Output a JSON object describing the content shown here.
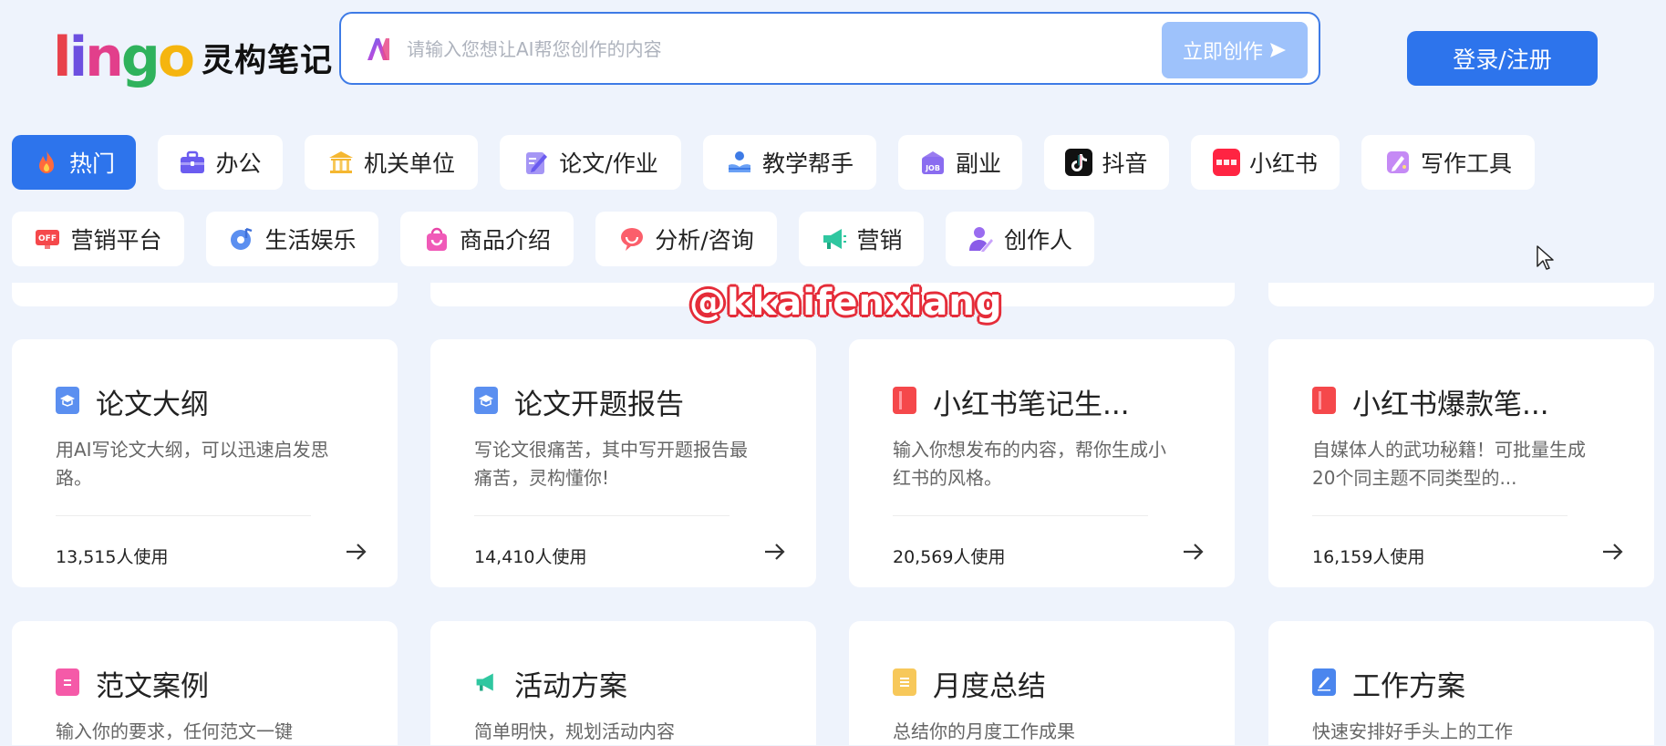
{
  "header": {
    "logo_mark": "lingo",
    "logo_text": "灵构笔记",
    "search_placeholder": "请输入您想让AI帮您创作的内容",
    "create_label": "立即创作",
    "login_label": "登录/注册"
  },
  "colors": {
    "accent": "#2d74ec",
    "background": "#eef3fc",
    "create_button": "#9ec2fb"
  },
  "categories": [
    {
      "label": "热门",
      "icon": "fire-icon",
      "active": true
    },
    {
      "label": "办公",
      "icon": "briefcase-icon"
    },
    {
      "label": "机关单位",
      "icon": "government-building-icon"
    },
    {
      "label": "论文/作业",
      "icon": "pencil-paper-icon"
    },
    {
      "label": "教学帮手",
      "icon": "teaching-hand-icon"
    },
    {
      "label": "副业",
      "icon": "job-bag-icon"
    },
    {
      "label": "抖音",
      "icon": "tiktok-icon"
    },
    {
      "label": "小红书",
      "icon": "xiaohongshu-icon"
    },
    {
      "label": "写作工具",
      "icon": "writing-pen-icon"
    },
    {
      "label": "营销平台",
      "icon": "marketing-screen-icon"
    },
    {
      "label": "生活娱乐",
      "icon": "music-disc-icon"
    },
    {
      "label": "商品介绍",
      "icon": "shopping-bag-icon"
    },
    {
      "label": "分析/咨询",
      "icon": "chat-bubble-icon"
    },
    {
      "label": "营销",
      "icon": "megaphone-icon"
    },
    {
      "label": "创作人",
      "icon": "creator-person-icon"
    }
  ],
  "cards": [
    {
      "title": "论文大纲",
      "desc": "用AI写论文大纲，可以迅速启发思路。",
      "count": "13,515人使用",
      "icon": "graduation-doc-icon"
    },
    {
      "title": "论文开题报告",
      "desc": "写论文很痛苦，其中写开题报告最痛苦，灵构懂你!",
      "count": "14,410人使用",
      "icon": "graduation-doc-icon"
    },
    {
      "title": "小红书笔记生...",
      "desc": "输入你想发布的内容，帮你生成小红书的风格。",
      "count": "20,569人使用",
      "icon": "red-book-icon"
    },
    {
      "title": "小红书爆款笔...",
      "desc": "自媒体人的武功秘籍！可批量生成20个同主题不同类型的...",
      "count": "16,159人使用",
      "icon": "red-book-icon"
    },
    {
      "title": "范文案例",
      "desc": "输入你的要求，任何范文一键",
      "count": "",
      "icon": "pink-doc-icon"
    },
    {
      "title": "活动方案",
      "desc": "简单明快，规划活动内容",
      "count": "",
      "icon": "megaphone-icon"
    },
    {
      "title": "月度总结",
      "desc": "总结你的月度工作成果",
      "count": "",
      "icon": "yellow-notes-icon"
    },
    {
      "title": "工作方案",
      "desc": "快速安排好手头上的工作",
      "count": "",
      "icon": "edit-board-icon"
    }
  ],
  "watermark": "@kkaifenxiang"
}
